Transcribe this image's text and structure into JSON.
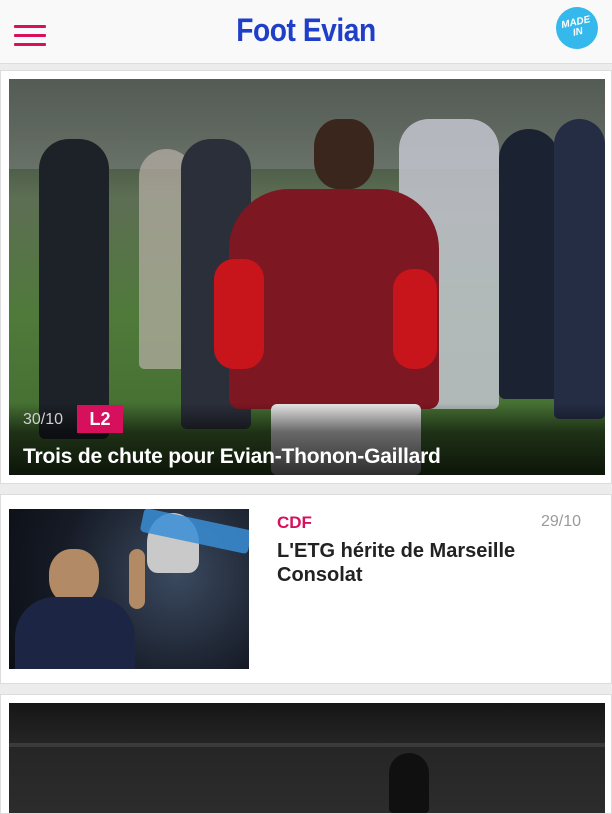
{
  "header": {
    "title": "Foot Evian",
    "badge_line1": "MADE",
    "badge_line2": "IN",
    "accent_color": "#d6105c",
    "title_color": "#1f3fc9"
  },
  "articles": [
    {
      "date": "30/10",
      "tag": "L2",
      "title": "Trois de chute pour Evian-Thonon-Gaillard",
      "image": "football-player-celebrating"
    },
    {
      "date": "29/10",
      "tag": "CDF",
      "title": "L'ETG hérite de Marseille Consolat",
      "image": "player-holding-trophy"
    },
    {
      "image": "stadium-night"
    }
  ]
}
